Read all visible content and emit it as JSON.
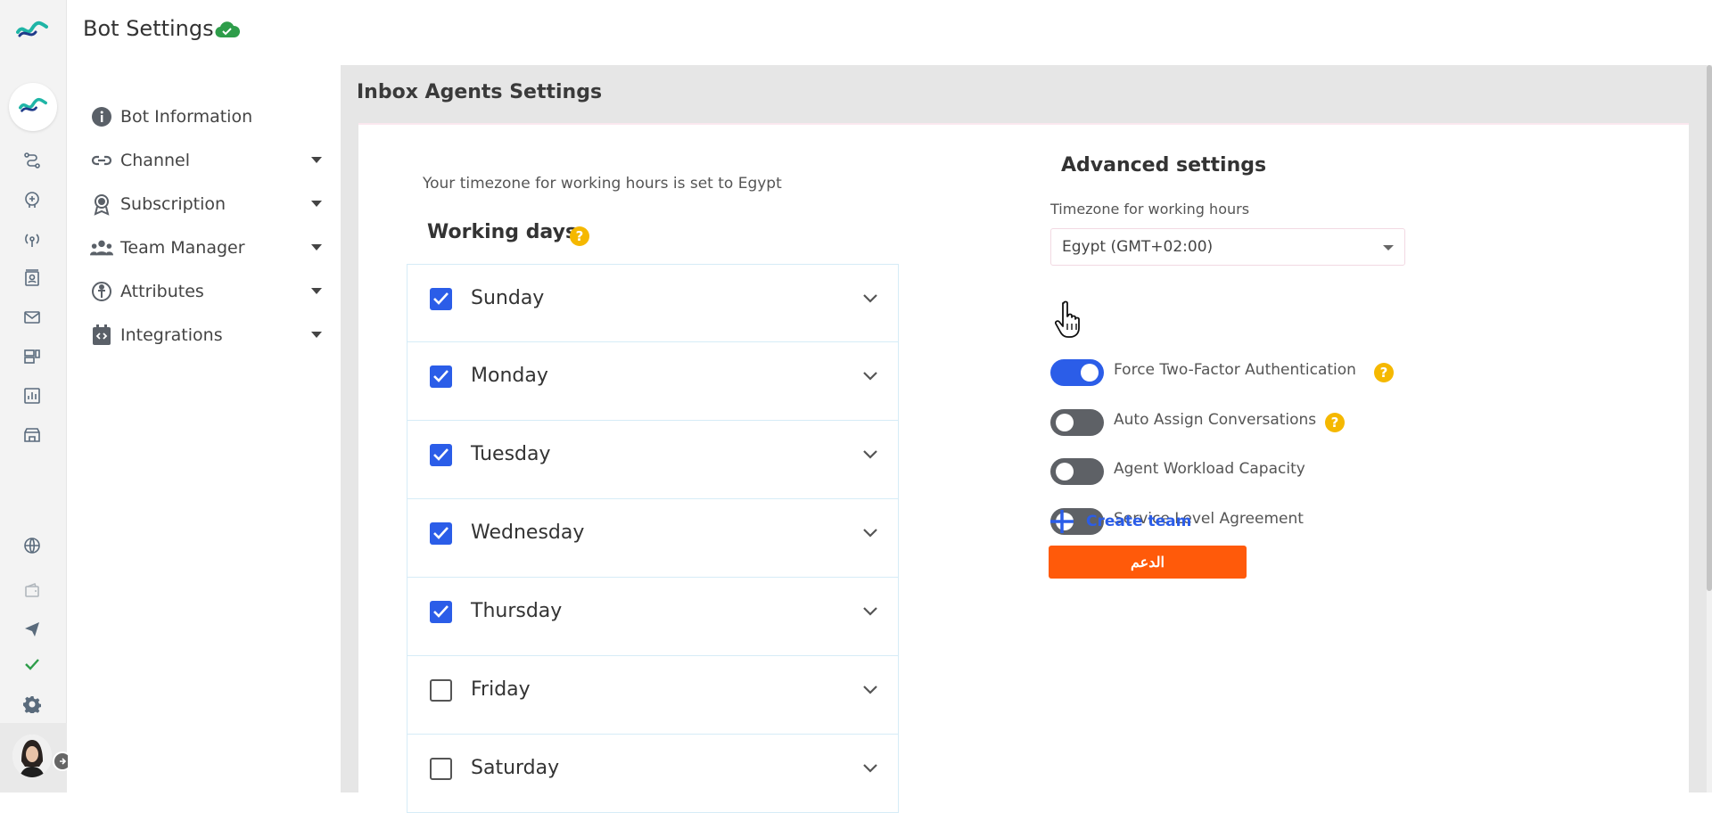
{
  "header": {
    "title": "Bot Settings",
    "status_icon": "cloud-check-icon"
  },
  "nav": {
    "items": [
      {
        "label": "Bot Information",
        "icon": "info-icon",
        "expandable": false
      },
      {
        "label": "Channel",
        "icon": "link-icon",
        "expandable": true
      },
      {
        "label": "Subscription",
        "icon": "award-icon",
        "expandable": true
      },
      {
        "label": "Team Manager",
        "icon": "team-icon",
        "expandable": true
      },
      {
        "label": "Attributes",
        "icon": "person-icon",
        "expandable": true
      },
      {
        "label": "Integrations",
        "icon": "code-icon",
        "expandable": true
      }
    ]
  },
  "rail": {
    "icons": [
      "flow-icon",
      "brain-icon",
      "broadcast-icon",
      "contacts-icon",
      "mail-icon",
      "templates-icon",
      "analytics-icon",
      "store-icon",
      "globe-icon",
      "wallet-icon",
      "send-icon",
      "check-icon",
      "settings-icon"
    ],
    "check_color": "#2e9d4a"
  },
  "main": {
    "section_title": "Inbox Agents Settings",
    "timezone_note": "Your timezone for working hours is set to Egypt",
    "working_days_title": "Working days",
    "days": [
      {
        "label": "Sunday",
        "checked": true
      },
      {
        "label": "Monday",
        "checked": true
      },
      {
        "label": "Tuesday",
        "checked": true
      },
      {
        "label": "Wednesday",
        "checked": true
      },
      {
        "label": "Thursday",
        "checked": true
      },
      {
        "label": "Friday",
        "checked": false
      },
      {
        "label": "Saturday",
        "checked": false
      }
    ],
    "advanced": {
      "title": "Advanced settings",
      "timezone_label": "Timezone for working hours",
      "timezone_value": "Egypt (GMT+02:00)",
      "toggles": [
        {
          "label": "Force Two-Factor Authentication",
          "on": true,
          "help": true
        },
        {
          "label": "Auto Assign Conversations",
          "on": false,
          "help": true
        },
        {
          "label": "Agent Workload Capacity",
          "on": false,
          "help": false
        },
        {
          "label": "Service Level Agreement",
          "on": false,
          "help": false
        }
      ],
      "create_team_label": "Create team",
      "support_button_label": "الدعم"
    }
  },
  "colors": {
    "accent": "#2b5de8",
    "support": "#ff5a0a",
    "help": "#f5b800",
    "brand_teal": "#1fb5a6"
  }
}
